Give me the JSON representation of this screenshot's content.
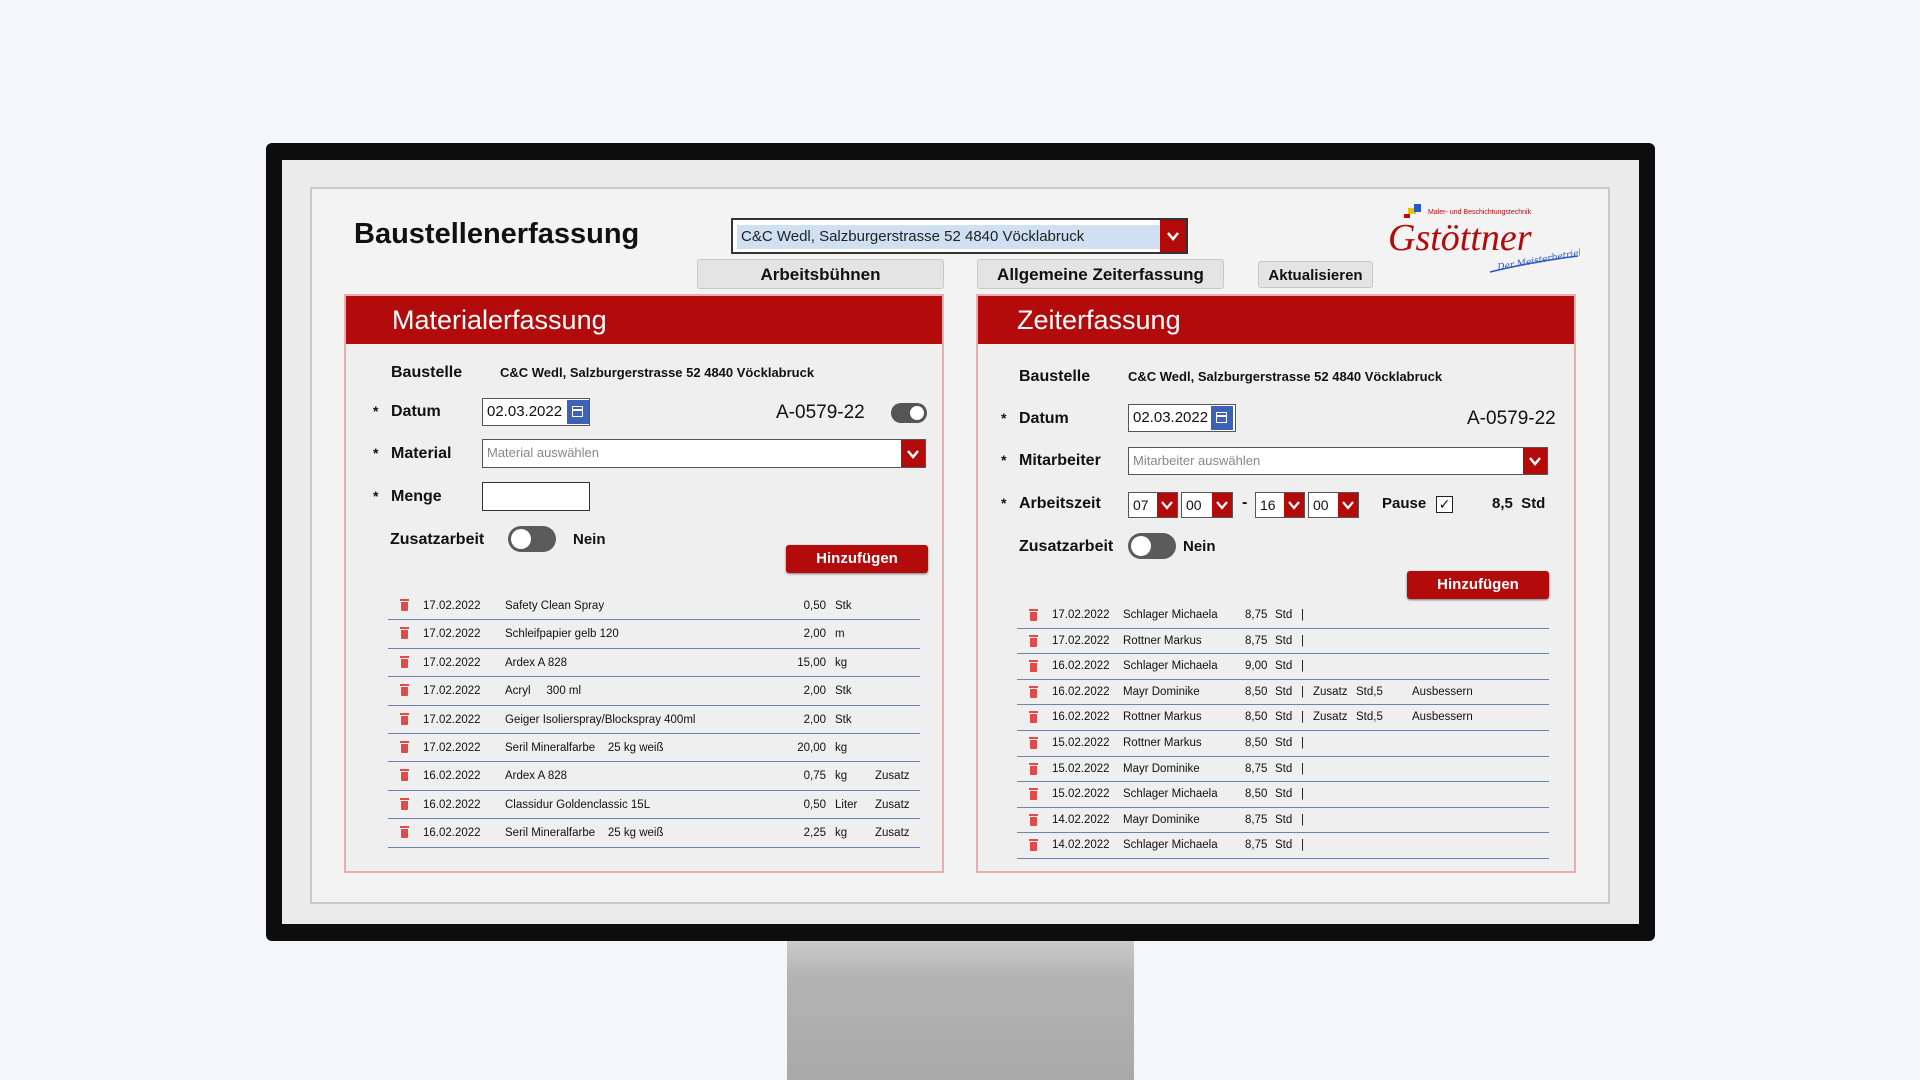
{
  "app": {
    "title": "Baustellenerfassung",
    "site_select_value": "C&C Wedl, Salzburgerstrasse 52 4840 Vöcklabruck",
    "buttons": {
      "arbeitsbuehnen": "Arbeitsbühnen",
      "zeiterfassung": "Allgemeine Zeiterfassung",
      "aktualisieren": "Aktualisieren"
    },
    "logo": {
      "name": "Gstöttner",
      "tagline": "Maler- und Beschichtungstechnik",
      "subline": "Der Meisterbetrieb"
    },
    "accent_color": "#b30b0b"
  },
  "material": {
    "title": "Materialerfassung",
    "baustelle_label": "Baustelle",
    "baustelle_value": "C&C Wedl, Salzburgerstrasse 52 4840 Vöcklabruck",
    "datum_label": "Datum",
    "datum_value": "02.03.2022",
    "code": "A-0579-22",
    "material_label": "Material",
    "material_placeholder": "Material auswählen",
    "menge_label": "Menge",
    "zusatz_label": "Zusatzarbeit",
    "zusatz_value": "Nein",
    "add_button": "Hinzufügen",
    "rows": [
      {
        "date": "17.02.2022",
        "name": "Safety Clean Spray",
        "qty": "0,50",
        "unit": "Stk",
        "extra": ""
      },
      {
        "date": "17.02.2022",
        "name": "Schleifpapier gelb 120",
        "qty": "2,00",
        "unit": "m",
        "extra": ""
      },
      {
        "date": "17.02.2022",
        "name": "Ardex A 828",
        "qty": "15,00",
        "unit": "kg",
        "extra": ""
      },
      {
        "date": "17.02.2022",
        "name": "Acryl     300 ml",
        "qty": "2,00",
        "unit": "Stk",
        "extra": ""
      },
      {
        "date": "17.02.2022",
        "name": "Geiger Isolierspray/Blockspray 400ml",
        "qty": "2,00",
        "unit": "Stk",
        "extra": ""
      },
      {
        "date": "17.02.2022",
        "name": "Seril Mineralfarbe    25 kg weiß",
        "qty": "20,00",
        "unit": "kg",
        "extra": ""
      },
      {
        "date": "16.02.2022",
        "name": "Ardex A 828",
        "qty": "0,75",
        "unit": "kg",
        "extra": "Zusatz"
      },
      {
        "date": "16.02.2022",
        "name": "Classidur Goldenclassic 15L",
        "qty": "0,50",
        "unit": "Liter",
        "extra": "Zusatz"
      },
      {
        "date": "16.02.2022",
        "name": "Seril Mineralfarbe    25 kg weiß",
        "qty": "2,25",
        "unit": "kg",
        "extra": "Zusatz"
      }
    ]
  },
  "zeit": {
    "title": "Zeiterfassung",
    "baustelle_label": "Baustelle",
    "baustelle_value": "C&C Wedl, Salzburgerstrasse 52 4840 Vöcklabruck",
    "datum_label": "Datum",
    "datum_value": "02.03.2022",
    "code": "A-0579-22",
    "mitarbeiter_label": "Mitarbeiter",
    "mitarbeiter_placeholder": "Mitarbeiter auswählen",
    "arbeitszeit_label": "Arbeitszeit",
    "start_h": "07",
    "start_m": "00",
    "separator": "-",
    "end_h": "16",
    "end_m": "00",
    "pause_label": "Pause",
    "pause_checked": "✓",
    "total": "8,5  Std",
    "zusatz_label": "Zusatzarbeit",
    "zusatz_value": "Nein",
    "add_button": "Hinzufügen",
    "rows": [
      {
        "date": "17.02.2022",
        "name": "Schlager Michaela",
        "hours": "8,75",
        "unit": "Std",
        "sep": "|",
        "zusatz": "",
        "zstd": "",
        "note": ""
      },
      {
        "date": "17.02.2022",
        "name": "Rottner Markus",
        "hours": "8,75",
        "unit": "Std",
        "sep": "|",
        "zusatz": "",
        "zstd": "",
        "note": ""
      },
      {
        "date": "16.02.2022",
        "name": "Schlager Michaela",
        "hours": "9,00",
        "unit": "Std",
        "sep": "|",
        "zusatz": "",
        "zstd": "",
        "note": ""
      },
      {
        "date": "16.02.2022",
        "name": "Mayr Dominike",
        "hours": "8,50",
        "unit": "Std",
        "sep": "|",
        "zusatz": "Zusatz",
        "zstd": "Std,5",
        "note": "Ausbessern"
      },
      {
        "date": "16.02.2022",
        "name": "Rottner Markus",
        "hours": "8,50",
        "unit": "Std",
        "sep": "|",
        "zusatz": "Zusatz",
        "zstd": "Std,5",
        "note": "Ausbessern"
      },
      {
        "date": "15.02.2022",
        "name": "Rottner Markus",
        "hours": "8,50",
        "unit": "Std",
        "sep": "|",
        "zusatz": "",
        "zstd": "",
        "note": ""
      },
      {
        "date": "15.02.2022",
        "name": "Mayr Dominike",
        "hours": "8,75",
        "unit": "Std",
        "sep": "|",
        "zusatz": "",
        "zstd": "",
        "note": ""
      },
      {
        "date": "15.02.2022",
        "name": "Schlager Michaela",
        "hours": "8,50",
        "unit": "Std",
        "sep": "|",
        "zusatz": "",
        "zstd": "",
        "note": ""
      },
      {
        "date": "14.02.2022",
        "name": "Mayr Dominike",
        "hours": "8,75",
        "unit": "Std",
        "sep": "|",
        "zusatz": "",
        "zstd": "",
        "note": ""
      },
      {
        "date": "14.02.2022",
        "name": "Schlager Michaela",
        "hours": "8,75",
        "unit": "Std",
        "sep": "|",
        "zusatz": "",
        "zstd": "",
        "note": ""
      }
    ]
  }
}
